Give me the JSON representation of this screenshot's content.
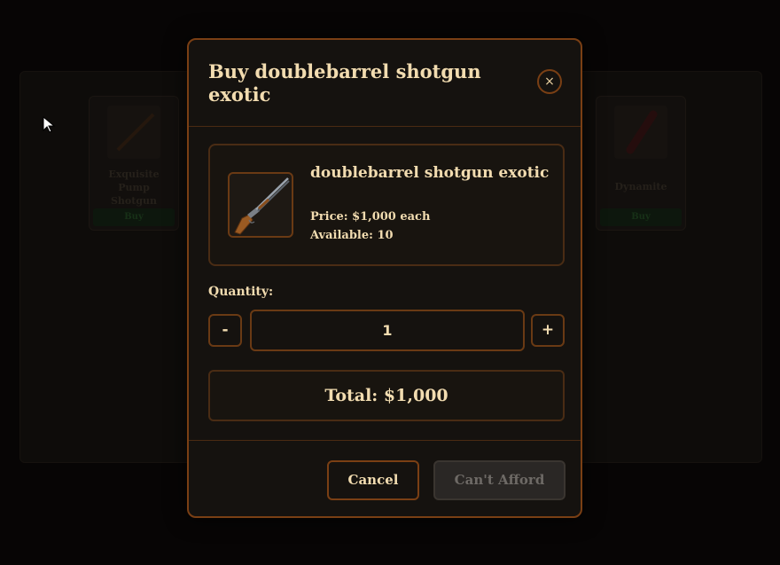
{
  "shop_background": {
    "cards": [
      {
        "name": "Exquisite Pump Shotgun",
        "button": "Buy"
      },
      {
        "name": "Dynamite",
        "button": "Buy"
      }
    ]
  },
  "modal": {
    "title": "Buy doublebarrel shotgun exotic",
    "close_glyph": "×",
    "item": {
      "name": "doublebarrel shotgun exotic",
      "price": "Price: $1,000 each",
      "available": "Available: 10",
      "icon": "doublebarrel-shotgun-icon"
    },
    "quantity": {
      "label": "Quantity:",
      "decrement_label": "-",
      "value": "1",
      "increment_label": "+"
    },
    "total": "Total: $1,000",
    "buttons": {
      "cancel": "Cancel",
      "confirm": "Can't Afford"
    }
  },
  "colors": {
    "accent_border": "#7a3f14",
    "text": "#f2dcb0",
    "background": "#15120f",
    "disabled": "#2a2725"
  }
}
